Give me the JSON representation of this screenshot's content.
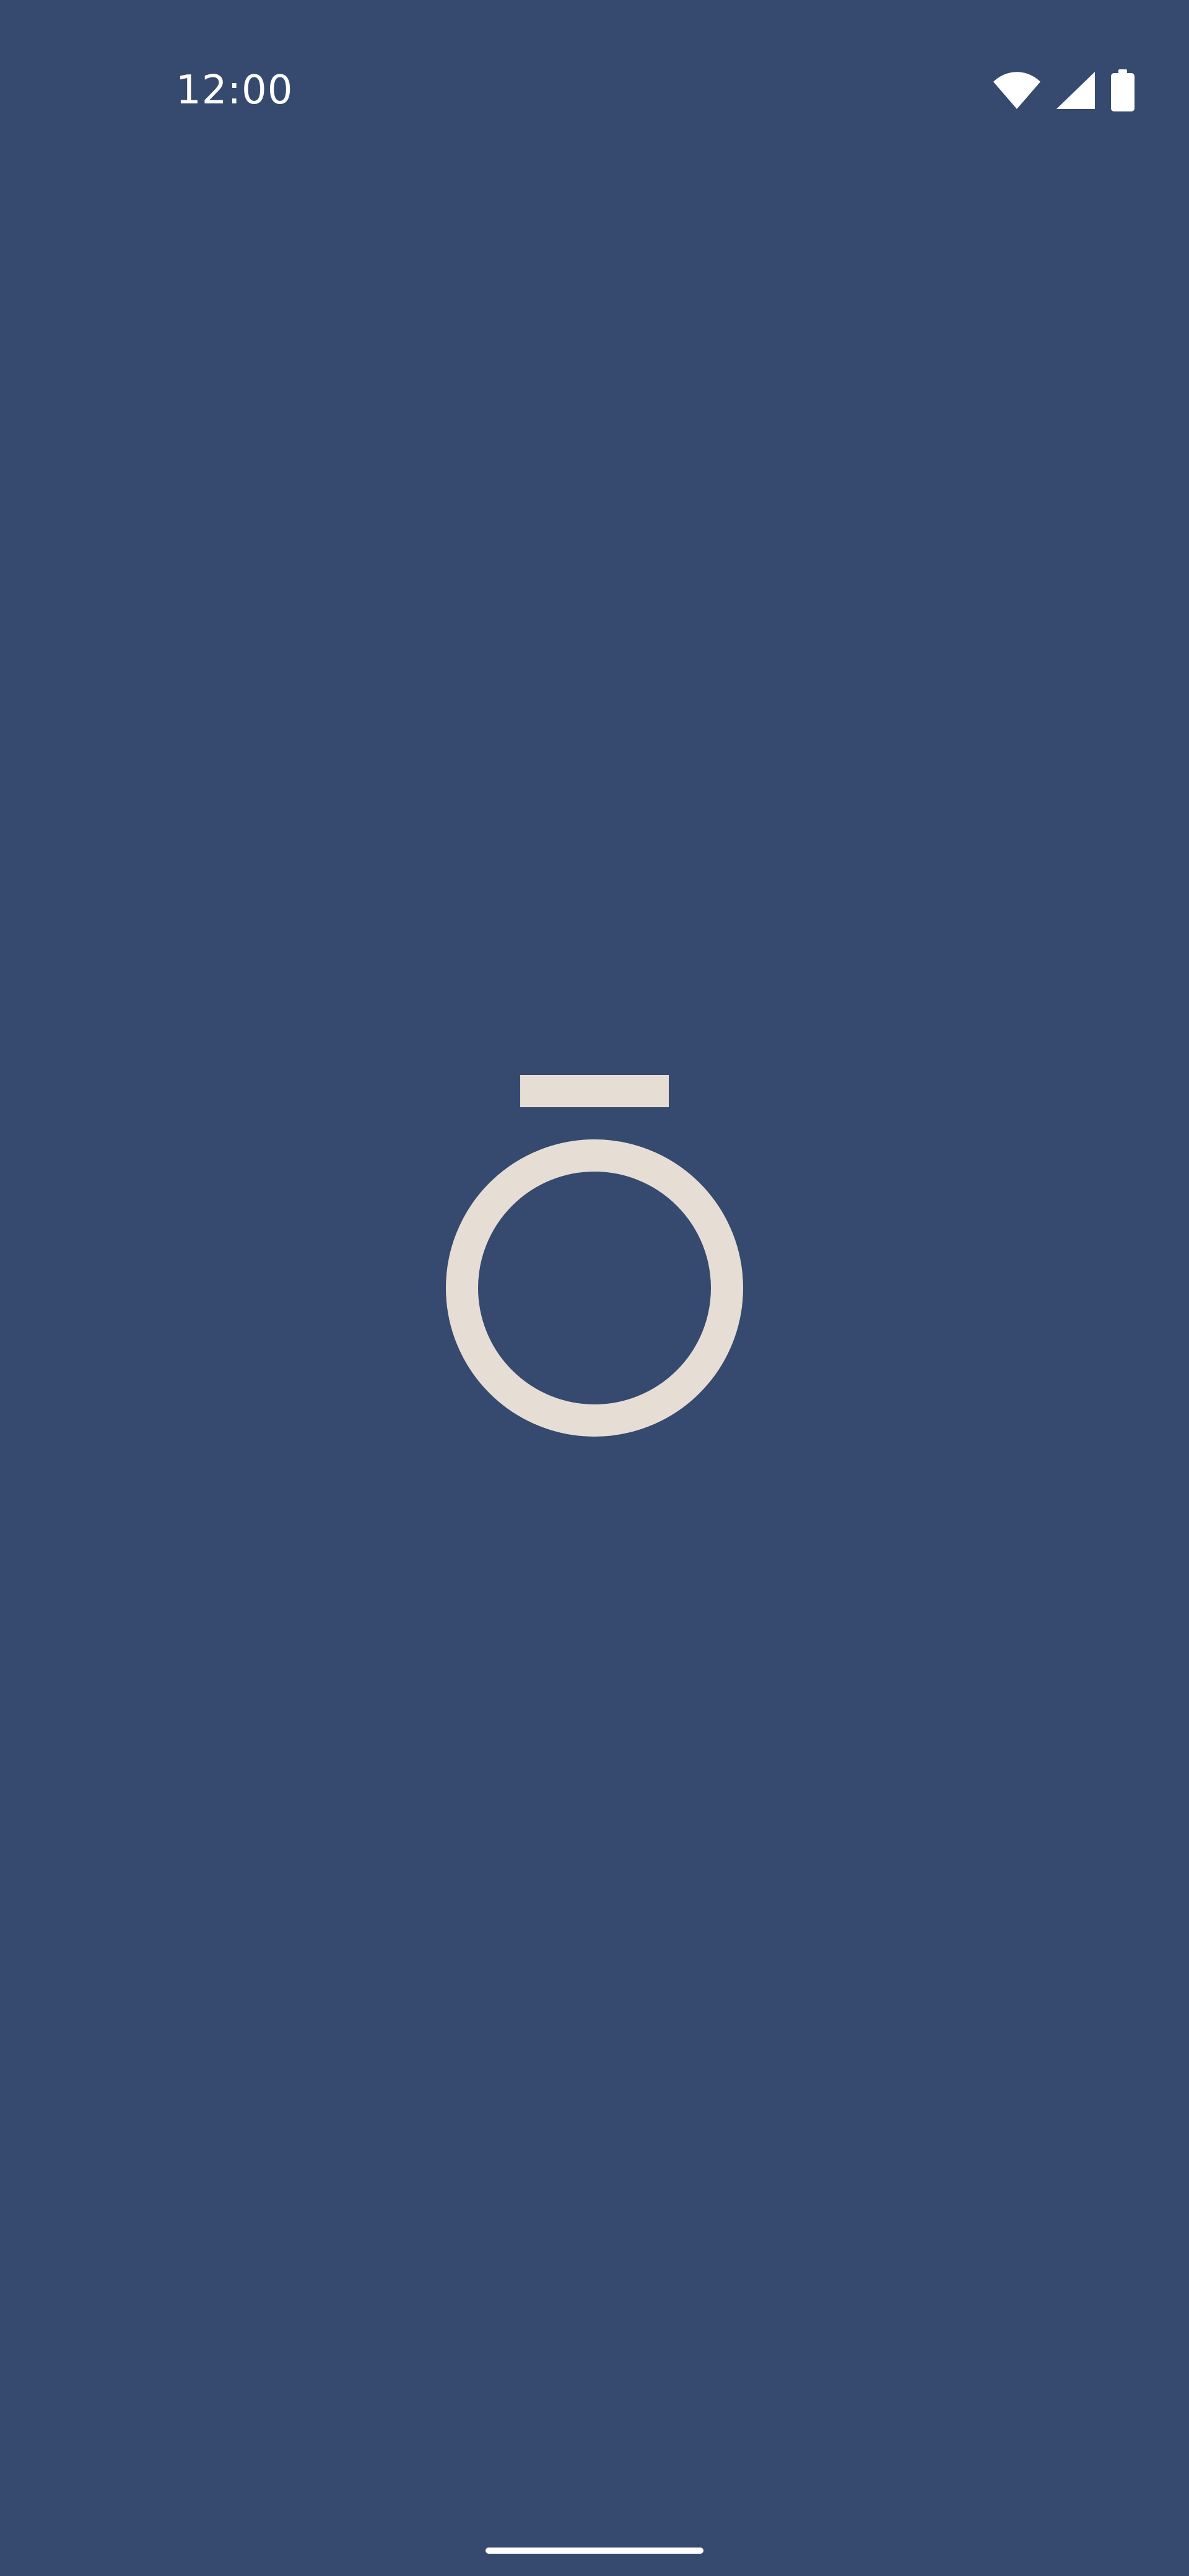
{
  "status_bar": {
    "time": "12:00",
    "icons": [
      "wifi-icon",
      "cellular-signal-icon",
      "battery-icon"
    ]
  },
  "splash": {
    "logo": "macron-o-logo-icon"
  },
  "colors": {
    "background": "#36496f",
    "logo": "#e6ddd4",
    "status_text": "#ffffff"
  }
}
